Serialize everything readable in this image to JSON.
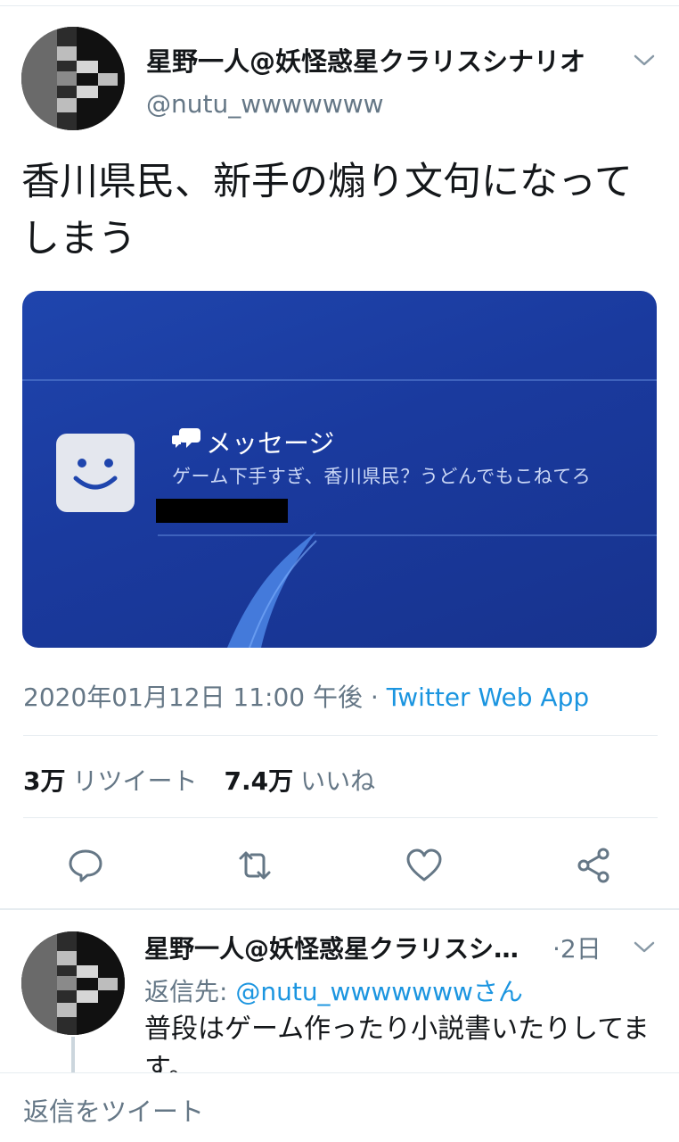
{
  "tweet": {
    "author_name": "星野一人@妖怪惑星クラリスシナリオ",
    "author_handle": "@nutu_wwwwwww",
    "text": "香川県民、新手の煽り文句になってしまう",
    "timestamp": "2020年01月12日 11:00 午後",
    "separator": " · ",
    "via": "Twitter Web App",
    "retweet_count": "3万",
    "retweet_label": "リツイート",
    "like_count": "7.4万",
    "like_label": "いいね"
  },
  "media": {
    "message_title": "メッセージ",
    "message_body": "ゲーム下手すぎ、香川県民？うどんでもこねてろ"
  },
  "actions": {
    "reply_icon": "reply-icon",
    "retweet_icon": "retweet-icon",
    "like_icon": "heart-icon",
    "share_icon": "share-icon"
  },
  "reply": {
    "author_name": "星野一人@妖怪惑星クラリスシナリオ",
    "time_prefix": "·",
    "time": "2日",
    "reply_to_label": "返信先:",
    "reply_to_mention": "@nutu_wwwwwwwさん",
    "text": "普段はゲーム作ったり小説書いたりしてます。"
  },
  "compose": {
    "placeholder": "返信をツイート"
  },
  "colors": {
    "link": "#1b95e0",
    "secondary_text": "#657786",
    "media_blue": "#1f45ad"
  }
}
